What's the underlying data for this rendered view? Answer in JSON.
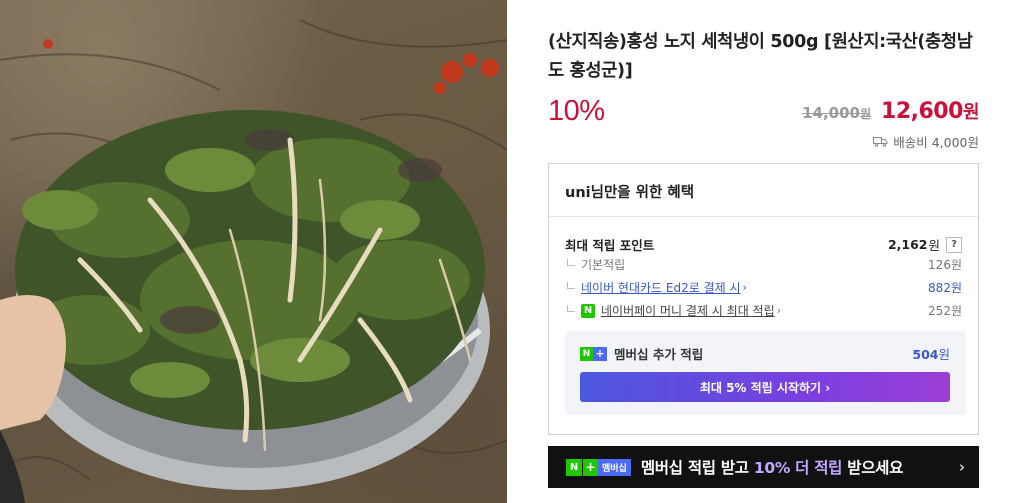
{
  "product": {
    "title": "(산지직송)홍성 노지 세척냉이 500g [원산지:국산(충청남도 홍성군)]",
    "discount": "10%",
    "original_price": "14,000",
    "original_price_unit": "원",
    "sale_price": "12,600",
    "sale_price_unit": "원",
    "shipping": "배송비 4,000원",
    "photo_icon": "product-photo-shepherds-purse"
  },
  "benefit": {
    "header": "uni님만을 위한 혜택",
    "max_points_label": "최대 적립 포인트",
    "max_points_value": "2,162",
    "won": "원",
    "help_label": "?",
    "basic_label": "기본적립",
    "basic_value": "126원",
    "card_label": "네이버 현대카드 Ed2로 결제 시",
    "card_value": "882원",
    "npay_badge": "N",
    "npay_label": "네이버페이 머니 결제 시 최대 적립",
    "npay_value": "252원",
    "chevron": "›",
    "membership": {
      "badge_n": "N",
      "badge_plus": "+",
      "label": "멤버십 추가 적립",
      "value": "504",
      "won": "원",
      "button_label": "최대 5% 적립 시작하기 ›"
    }
  },
  "banner": {
    "badge_n": "N",
    "badge_plus": "+",
    "badge_text": "멤버십",
    "msg_before": "멤버십 적립 받고 ",
    "msg_highlight": "10% 더 적립",
    "msg_after": " 받으세요",
    "arrow": "›"
  },
  "colors": {
    "accent_red": "#c9123b",
    "link_blue": "#3a59c9",
    "naver_green": "#1ec800",
    "membership_gradient_start": "#4c58e0",
    "membership_gradient_end": "#9b3ed6",
    "banner_bg": "#111111"
  }
}
